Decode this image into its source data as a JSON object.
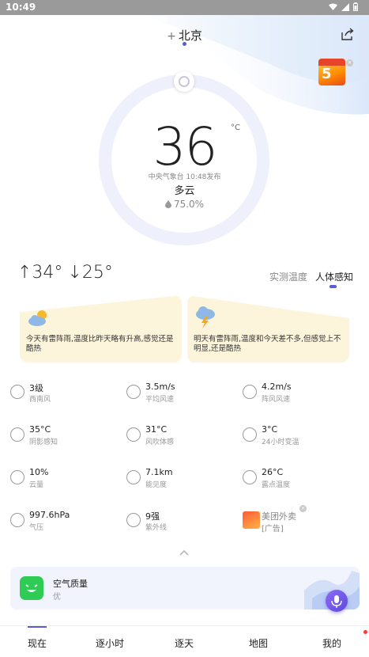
{
  "status_bar": {
    "time": "10:49"
  },
  "header": {
    "plus": "+",
    "city": "北京"
  },
  "current": {
    "temperature": "36",
    "unit": "°C",
    "publish": "中央气象台 10:48发布",
    "condition": "多云",
    "humidity": "75.0%"
  },
  "range": {
    "high": "↑34°",
    "low": "↓25°"
  },
  "toggle": {
    "measured": "实测温度",
    "feels": "人体感知"
  },
  "forecast": {
    "today": "今天有雷阵雨,温度比昨天略有升高,感觉还是酷热",
    "tomorrow": "明天有雷阵雨,温度和今天差不多,但感觉上不明显,还是酷热"
  },
  "details": [
    {
      "value": "3级",
      "label": "西南风"
    },
    {
      "value": "3.5m/s",
      "label": "平均风速"
    },
    {
      "value": "4.2m/s",
      "label": "阵风风速"
    },
    {
      "value": "35°C",
      "label": "阴影感知"
    },
    {
      "value": "31°C",
      "label": "风吹体感"
    },
    {
      "value": "3°C",
      "label": "24小时变温"
    },
    {
      "value": "10%",
      "label": "云量"
    },
    {
      "value": "7.1km",
      "label": "能见度"
    },
    {
      "value": "26°C",
      "label": "露点温度"
    },
    {
      "value": "997.6hPa",
      "label": "气压"
    },
    {
      "value": "9强",
      "label": "紫外线"
    },
    {
      "value": "美团外卖",
      "label": "[广告]"
    }
  ],
  "air_quality": {
    "title": "空气质量",
    "value": "优"
  },
  "nav": [
    "现在",
    "逐小时",
    "逐天",
    "地图",
    "我的"
  ],
  "colors": {
    "accent": "#5b5bd6",
    "card": "#fdf5db",
    "aqi_good": "#2ecc55"
  }
}
